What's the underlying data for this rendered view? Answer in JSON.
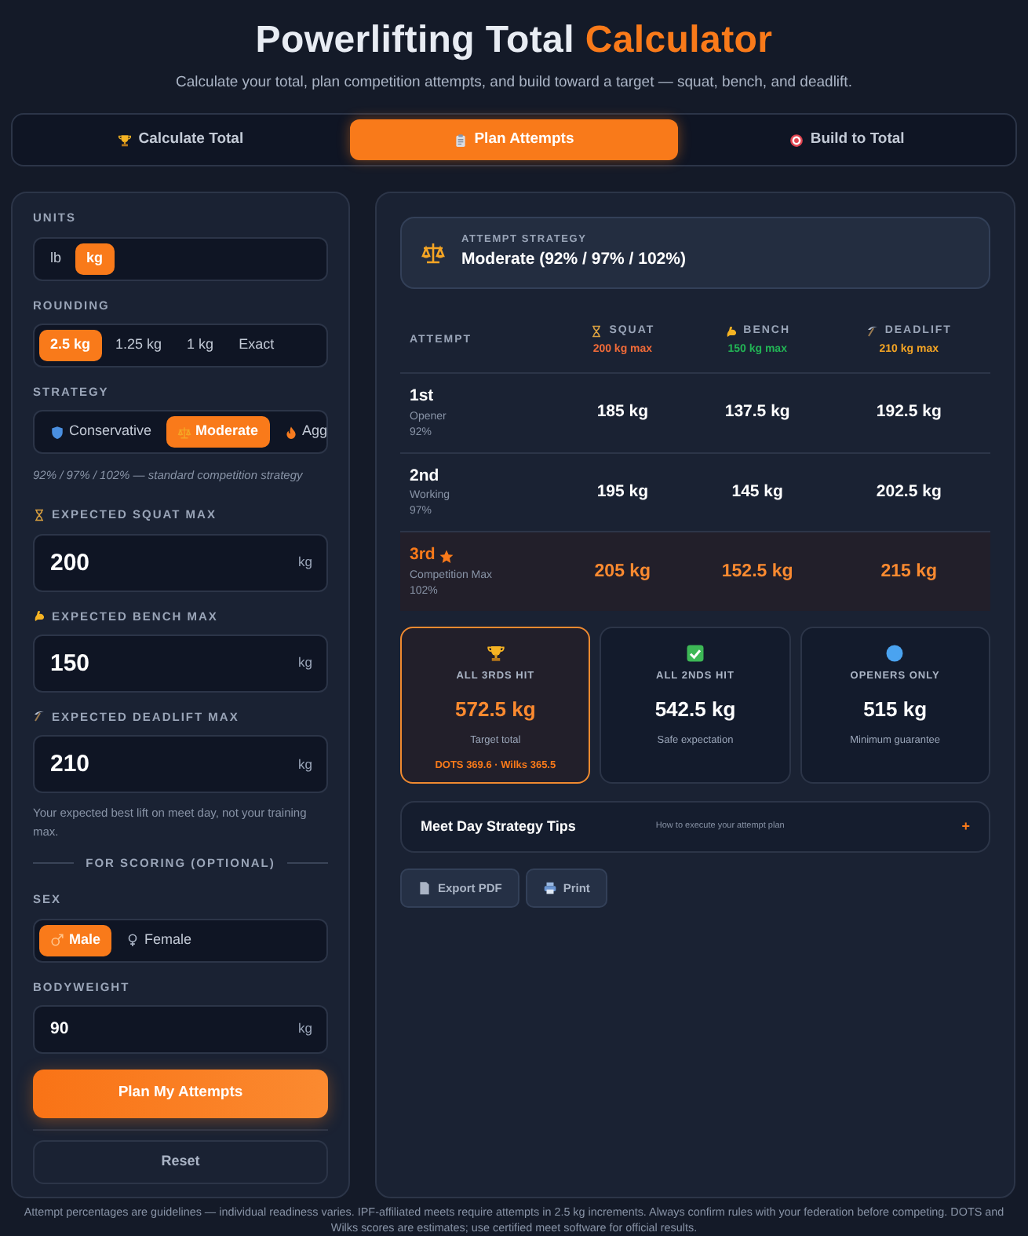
{
  "header": {
    "title": "Powerlifting Total",
    "title_accent": "Calculator",
    "subtitle": "Calculate your total, plan competition attempts, and build toward a target — squat, bench, and deadlift."
  },
  "tabs": [
    {
      "label": "Calculate Total",
      "selected": false
    },
    {
      "label": "Plan Attempts",
      "selected": true
    },
    {
      "label": "Build to Total",
      "selected": false
    }
  ],
  "form": {
    "units": {
      "label": "UNITS",
      "options": [
        {
          "label": "lb",
          "selected": false
        },
        {
          "label": "kg",
          "selected": true
        }
      ]
    },
    "rounding": {
      "label": "ROUNDING",
      "options": [
        {
          "label": "2.5 kg",
          "selected": true
        },
        {
          "label": "1.25 kg",
          "selected": false
        },
        {
          "label": "1 kg",
          "selected": false
        },
        {
          "label": "Exact",
          "selected": false
        }
      ]
    },
    "strategy": {
      "label": "STRATEGY",
      "options": [
        {
          "label": "Conservative",
          "selected": false
        },
        {
          "label": "Moderate",
          "selected": true
        },
        {
          "label": "Agg",
          "selected": false
        }
      ],
      "note": "92% / 97% / 102% — standard competition strategy"
    },
    "lifts": [
      {
        "label": "EXPECTED SQUAT MAX",
        "value": "200",
        "unit": "kg"
      },
      {
        "label": "EXPECTED BENCH MAX",
        "value": "150",
        "unit": "kg"
      },
      {
        "label": "EXPECTED DEADLIFT MAX",
        "value": "210",
        "unit": "kg"
      }
    ],
    "lift_help": "Your expected best lift on meet day, not your training max.",
    "scoring_divider": "FOR SCORING (OPTIONAL)",
    "sex": {
      "label": "SEX",
      "options": [
        {
          "label": "Male",
          "selected": true
        },
        {
          "label": "Female",
          "selected": false
        }
      ]
    },
    "bodyweight": {
      "label": "BODYWEIGHT",
      "value": "90",
      "unit": "kg"
    },
    "submit": "Plan My Attempts",
    "reset": "Reset"
  },
  "results": {
    "strategy_card": {
      "label": "ATTEMPT STRATEGY",
      "value": "Moderate (92% / 97% / 102%)"
    },
    "table": {
      "first_column": "ATTEMPT",
      "columns": [
        {
          "label": "SQUAT",
          "max": "200 kg max",
          "color": "#f26b38"
        },
        {
          "label": "BENCH",
          "max": "150 kg max",
          "color": "#22b455"
        },
        {
          "label": "DEADLIFT",
          "max": "210 kg max",
          "color": "#f5a524"
        }
      ],
      "rows": [
        {
          "attempt": "1st",
          "star": false,
          "name": "Opener",
          "percent": "92%",
          "highlighted": false,
          "values": [
            "185 kg",
            "137.5 kg",
            "192.5 kg"
          ]
        },
        {
          "attempt": "2nd",
          "star": false,
          "name": "Working",
          "percent": "97%",
          "highlighted": false,
          "values": [
            "195 kg",
            "145 kg",
            "202.5 kg"
          ]
        },
        {
          "attempt": "3rd",
          "star": true,
          "name": "Competition Max",
          "percent": "102%",
          "highlighted": true,
          "values": [
            "205 kg",
            "152.5 kg",
            "215 kg"
          ]
        }
      ]
    },
    "totals": [
      {
        "label": "ALL 3RDS HIT",
        "value": "572.5 kg",
        "caption": "Target total",
        "scores": "DOTS 369.6 · Wilks 365.5",
        "highlighted": true
      },
      {
        "label": "ALL 2NDS HIT",
        "value": "542.5 kg",
        "caption": "Safe expectation",
        "highlighted": false
      },
      {
        "label": "OPENERS ONLY",
        "value": "515 kg",
        "caption": "Minimum guarantee",
        "highlighted": false
      }
    ],
    "tips": {
      "title": "Meet Day Strategy Tips",
      "subtitle": "How to execute your attempt plan",
      "toggle": "+",
      "expanded": false
    },
    "actions": [
      {
        "label": "Export PDF"
      },
      {
        "label": "Print"
      }
    ]
  },
  "footer": "Attempt percentages are guidelines — individual readiness varies. IPF-affiliated meets require attempts in 2.5 kg increments. Always confirm rules with your federation before competing. DOTS and Wilks scores are estimates; use certified meet software for official results."
}
